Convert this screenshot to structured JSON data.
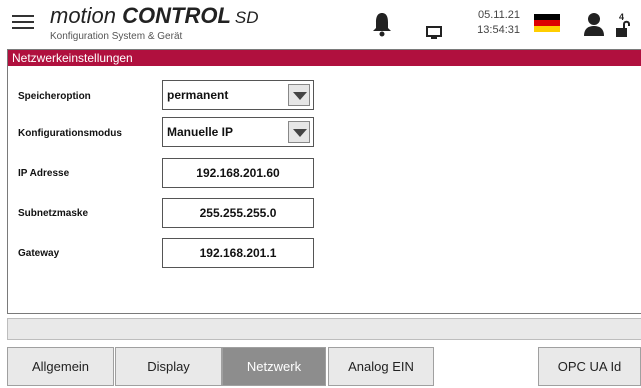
{
  "header": {
    "brand_part1": "motion ",
    "brand_part2": "CONTROL",
    "brand_part3": "SD",
    "subtitle": "Konfiguration System & Gerät",
    "date": "05.11.21",
    "time": "13:54:31",
    "user_level": "4",
    "icons": [
      "menu-icon",
      "bell-icon",
      "monitor-icon",
      "german-flag-icon",
      "user-icon",
      "unlock-icon"
    ]
  },
  "panel": {
    "title": "Netzwerkeinstellungen",
    "storage_label": "Speicheroption",
    "storage_value": "permanent",
    "mode_label": "Konfigurationsmodus",
    "mode_value": "Manuelle IP",
    "ip_label": "IP Adresse",
    "ip_value": "192.168.201.60",
    "subnet_label": "Subnetzmaske",
    "subnet_value": "255.255.255.0",
    "gateway_label": "Gateway",
    "gateway_value": "192.168.201.1"
  },
  "tabs": [
    {
      "label": "Allgemein"
    },
    {
      "label": "Display"
    },
    {
      "label": "Netzwerk"
    },
    {
      "label": "Analog EIN"
    },
    {
      "label": "OPC UA Id"
    }
  ],
  "colors": {
    "accent": "#b0103e",
    "active_tab": "#8d8d8d",
    "tab_bg": "#e9e9e9"
  }
}
